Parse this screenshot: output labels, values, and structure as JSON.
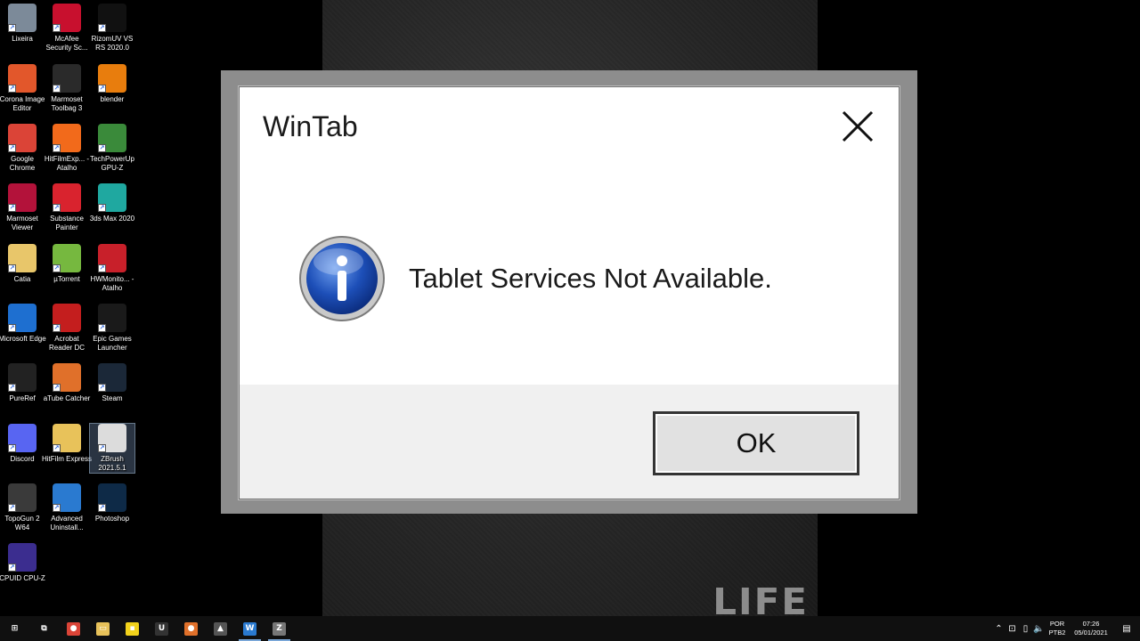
{
  "desktop": {
    "icons": [
      {
        "label": "Lixeira",
        "icon": "recycle-bin-icon",
        "color": "#7c8a99"
      },
      {
        "label": "McAfee Security Sc...",
        "icon": "mcafee-icon",
        "color": "#c8102e"
      },
      {
        "label": "RizomUV VS RS 2020.0",
        "icon": "rizomuv-icon",
        "color": "#111111"
      },
      {
        "label": "Corona Image Editor",
        "icon": "corona-icon",
        "color": "#e2572b"
      },
      {
        "label": "Marmoset Toolbag 3",
        "icon": "marmoset-toolbag-icon",
        "color": "#2a2a2a"
      },
      {
        "label": "blender",
        "icon": "blender-icon",
        "color": "#e87d0d"
      },
      {
        "label": "Google Chrome",
        "icon": "chrome-icon",
        "color": "#db4437"
      },
      {
        "label": "HitFilmExp... - Atalho",
        "icon": "hitfilm-icon",
        "color": "#f26a1b"
      },
      {
        "label": "TechPowerUp GPU-Z",
        "icon": "gpuz-icon",
        "color": "#3a8a3a"
      },
      {
        "label": "Marmoset Viewer",
        "icon": "marmoset-viewer-icon",
        "color": "#b3123a"
      },
      {
        "label": "Substance Painter",
        "icon": "substance-painter-icon",
        "color": "#d9232e"
      },
      {
        "label": "3ds Max 2020",
        "icon": "3dsmax-icon",
        "color": "#1fa8a0"
      },
      {
        "label": "Catia",
        "icon": "catia-icon",
        "color": "#e8c66a"
      },
      {
        "label": "µTorrent",
        "icon": "utorrent-icon",
        "color": "#76b83f"
      },
      {
        "label": "HWMonito... - Atalho",
        "icon": "hwmonitor-icon",
        "color": "#c8202a"
      },
      {
        "label": "Microsoft Edge",
        "icon": "edge-icon",
        "color": "#1e6fd0"
      },
      {
        "label": "Acrobat Reader DC",
        "icon": "acrobat-icon",
        "color": "#c41e1e"
      },
      {
        "label": "Epic Games Launcher",
        "icon": "epic-games-icon",
        "color": "#1a1a1a"
      },
      {
        "label": "PureRef",
        "icon": "pureref-icon",
        "color": "#222222"
      },
      {
        "label": "aTube Catcher",
        "icon": "atube-catcher-icon",
        "color": "#e0702a"
      },
      {
        "label": "Steam",
        "icon": "steam-icon",
        "color": "#1b2838"
      },
      {
        "label": "Discord",
        "icon": "discord-icon",
        "color": "#5865f2"
      },
      {
        "label": "HitFilm Express",
        "icon": "folder-icon",
        "color": "#e8c25a"
      },
      {
        "label": "ZBrush 2021.5.1",
        "icon": "zbrush-icon",
        "color": "#dcdcdc"
      },
      {
        "label": "TopoGun 2 W64",
        "icon": "topogun-icon",
        "color": "#3a3a3a"
      },
      {
        "label": "Advanced Uninstall...",
        "icon": "advanced-uninstaller-icon",
        "color": "#2a7ad0"
      },
      {
        "label": "Photoshop",
        "icon": "photoshop-icon",
        "color": "#0e2a47"
      },
      {
        "label": "CPUID CPU-Z",
        "icon": "cpuz-icon",
        "color": "#3b2d8f"
      }
    ]
  },
  "splash": {
    "logo_text": "LIFE"
  },
  "dialog": {
    "title": "WinTab",
    "message": "Tablet Services Not Available.",
    "ok_label": "OK",
    "icon": "information-icon",
    "icon_color": "#1d4fb8"
  },
  "taskbar": {
    "apps": [
      {
        "icon": "start-icon",
        "label": "⊞",
        "color": "#ffffff"
      },
      {
        "icon": "task-view-icon",
        "label": "⧉",
        "color": "#ffffff"
      },
      {
        "icon": "chrome-icon",
        "label": "●",
        "color": "#db4437"
      },
      {
        "icon": "file-explorer-icon",
        "label": "▭",
        "color": "#e8c25a"
      },
      {
        "icon": "sticky-notes-icon",
        "label": "▪",
        "color": "#f2d21b"
      },
      {
        "icon": "unreal-icon",
        "label": "U",
        "color": "#333333"
      },
      {
        "icon": "atube-catcher-icon",
        "label": "●",
        "color": "#e0702a"
      },
      {
        "icon": "photos-icon",
        "label": "▲",
        "color": "#555555"
      },
      {
        "icon": "wintab-icon",
        "label": "W",
        "color": "#2a7ad0"
      },
      {
        "icon": "zbrush-icon",
        "label": "Z",
        "color": "#777777"
      }
    ],
    "tray": {
      "language": "POR",
      "layout": "PTB2",
      "time": "07:26",
      "date": "05/01/2021"
    }
  }
}
